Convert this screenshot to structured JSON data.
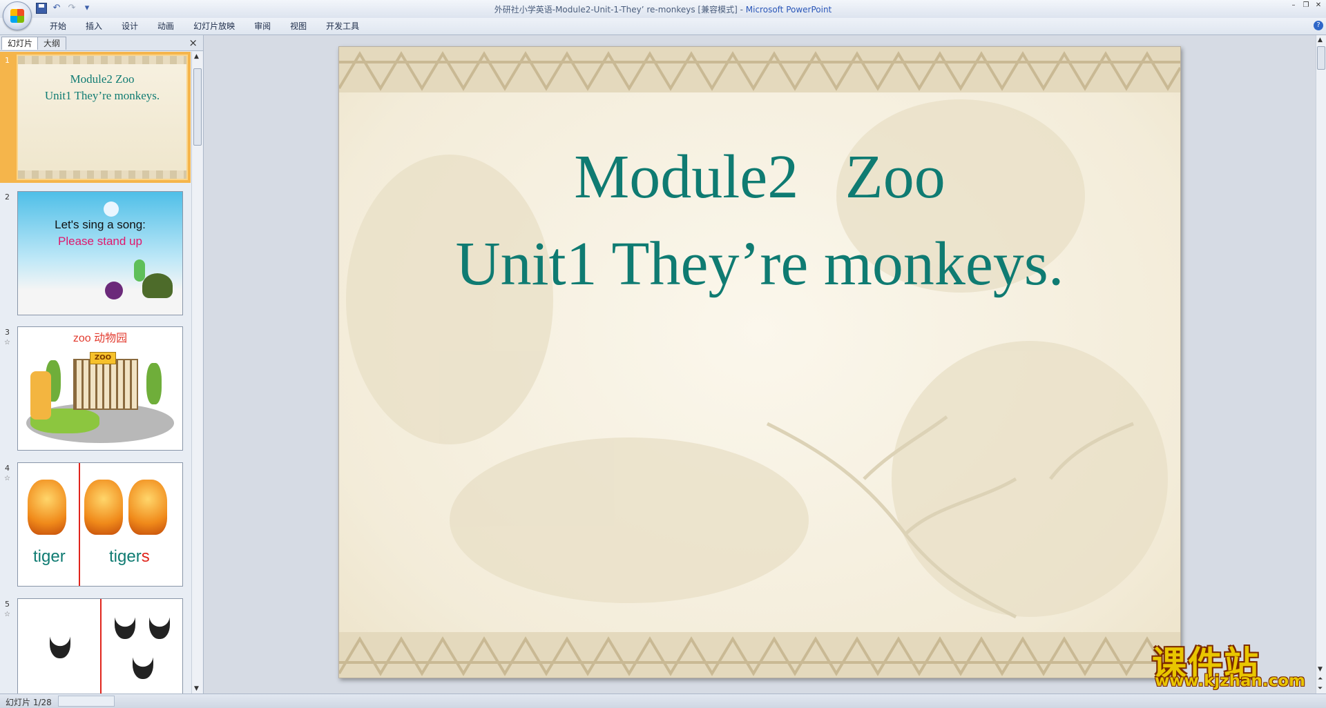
{
  "window": {
    "doc_title": "外研社小学英语-Module2-Unit-1-They’ re-monkeys [兼容模式]",
    "separator": " - ",
    "app_name": "Microsoft PowerPoint"
  },
  "quick_access": {
    "icons": [
      "save-icon",
      "undo-icon",
      "redo-icon",
      "customize-icon"
    ]
  },
  "ribbon": {
    "tabs": [
      "开始",
      "插入",
      "设计",
      "动画",
      "幻灯片放映",
      "审阅",
      "视图",
      "开发工具"
    ]
  },
  "left_panel": {
    "tab_slides": "幻灯片",
    "tab_outline": "大纲",
    "close": "×",
    "thumbnails": [
      {
        "num": "1",
        "line1": "Module2   Zoo",
        "line2": "Unit1 They’re monkeys."
      },
      {
        "num": "2",
        "line1": "Let's sing a song:",
        "line2": "Please stand up"
      },
      {
        "num": "3",
        "title": "zoo 动物园",
        "sign": "ZOO"
      },
      {
        "num": "4",
        "left_word": "tiger",
        "right_word": "tiger",
        "right_suffix": "s"
      },
      {
        "num": "5"
      }
    ]
  },
  "slide": {
    "title": "Module2   Zoo",
    "subtitle": "Unit1 They’re monkeys.",
    "text_color": "#0f7b72"
  },
  "status": {
    "slide_info": "幻灯片 1/28"
  },
  "watermark": {
    "cn": "课件站",
    "url": "www.kjzhan.com"
  },
  "colors": {
    "accent": "#0f7b72",
    "selection": "#f5b54b",
    "red": "#e0241b",
    "pink": "#e0186c"
  }
}
